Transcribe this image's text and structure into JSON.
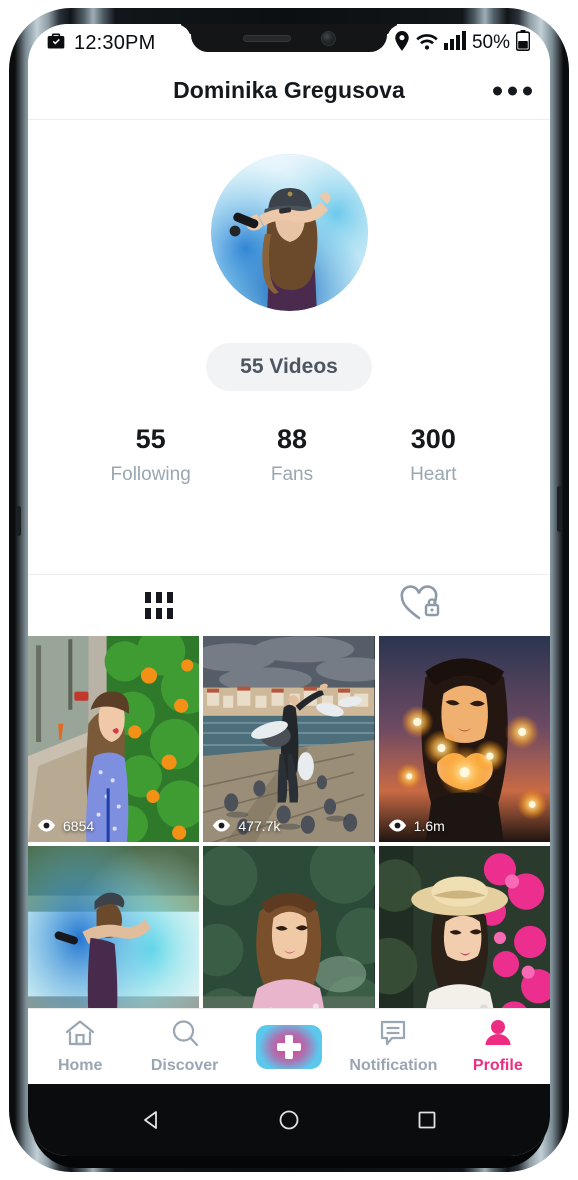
{
  "status_bar": {
    "time": "12:30PM",
    "battery_percent": "50%",
    "icons": [
      "briefcase-check-icon",
      "location-pin-icon",
      "wifi-icon",
      "signal-bars-icon",
      "battery-icon"
    ]
  },
  "header": {
    "title": "Dominika Gregusova",
    "menu_label": "more-options"
  },
  "profile": {
    "avatar_alt": "user-avatar",
    "videos_pill": "55 Videos",
    "stats": [
      {
        "value": "55",
        "label": "Following"
      },
      {
        "value": "88",
        "label": "Fans"
      },
      {
        "value": "300",
        "label": "Heart"
      }
    ]
  },
  "tabs": [
    {
      "id": "grid",
      "icon": "grid-icon",
      "active": true
    },
    {
      "id": "private-likes",
      "icon": "heart-lock-icon",
      "active": false
    }
  ],
  "videos": [
    {
      "views": "6854",
      "alt": "woman-in-blue-dress-on-flower-lined-street"
    },
    {
      "views": "477.7k",
      "alt": "person-with-guitar-on-lakeside-pier-with-birds"
    },
    {
      "views": "1.6m",
      "alt": "woman-holding-glowing-string-lights-at-dusk"
    },
    {
      "views": "",
      "alt": "person-with-blue-smoke-bomb"
    },
    {
      "views": "",
      "alt": "woman-in-pink-top-by-green-foliage"
    },
    {
      "views": "",
      "alt": "woman-in-straw-hat-beside-pink-flowers"
    }
  ],
  "bottom_nav": [
    {
      "label": "Home",
      "icon": "home-icon",
      "active": false
    },
    {
      "label": "Discover",
      "icon": "search-icon",
      "active": false
    },
    {
      "label": "",
      "icon": "add-plus-icon",
      "active": false
    },
    {
      "label": "Notification",
      "icon": "message-icon",
      "active": false
    },
    {
      "label": "Profile",
      "icon": "person-icon",
      "active": true
    }
  ],
  "android_nav": [
    {
      "icon": "back-triangle-icon"
    },
    {
      "icon": "home-circle-icon"
    },
    {
      "icon": "recents-square-icon"
    }
  ],
  "colors": {
    "accent_pink": "#ee2d82",
    "accent_cyan": "#5bc8ec",
    "muted_text": "#9aa6b2",
    "dark_text": "#15181c",
    "pill_bg": "#f1f3f5"
  }
}
